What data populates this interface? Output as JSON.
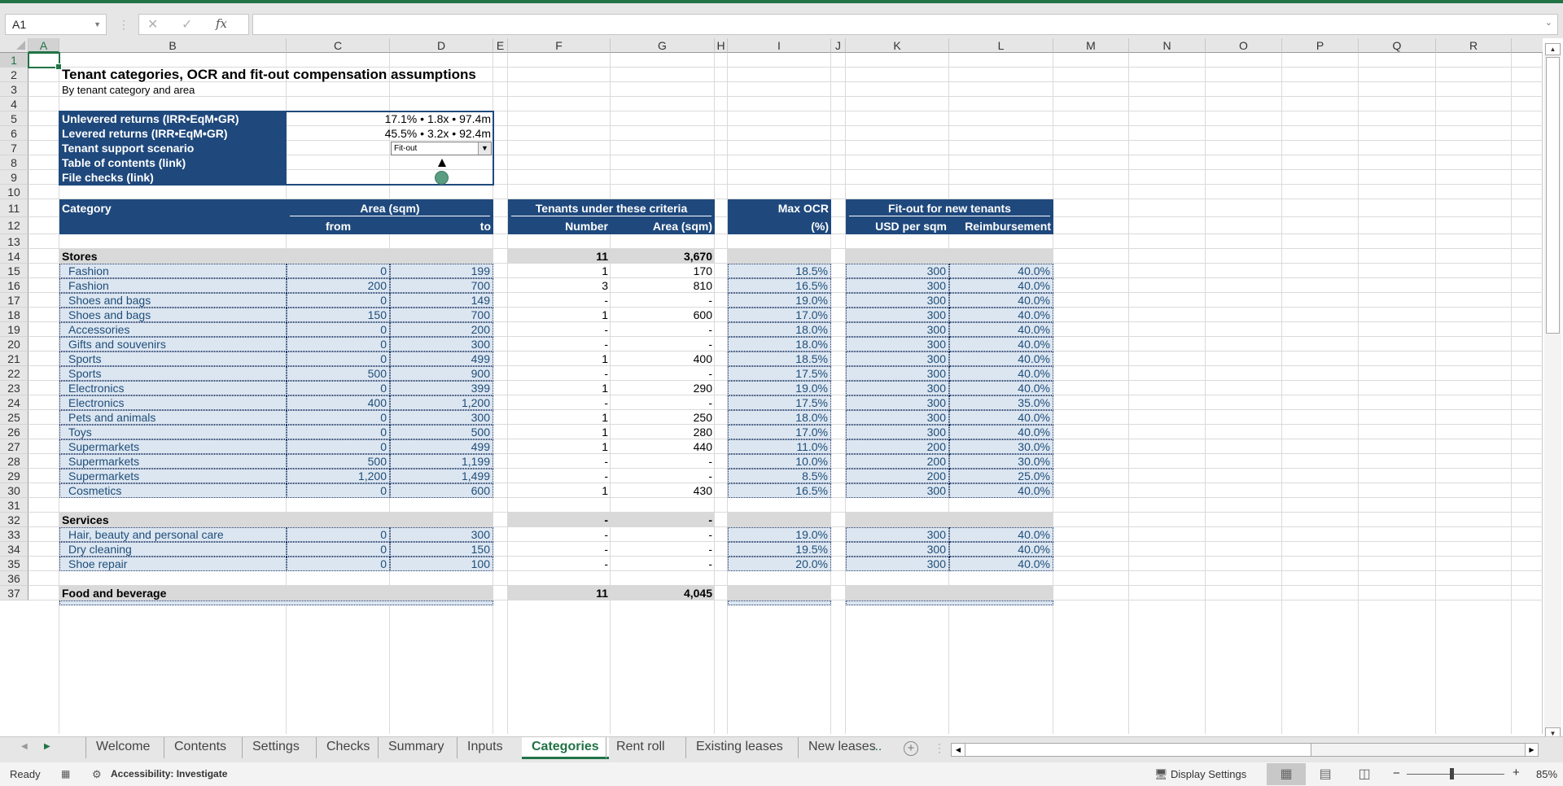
{
  "app": {
    "name_box": "A1",
    "formula_value": "",
    "formula_icons": [
      "cancel-icon",
      "enter-icon",
      "function-icon"
    ]
  },
  "columns": [
    "A",
    "B",
    "C",
    "D",
    "E",
    "F",
    "G",
    "H",
    "I",
    "J",
    "K",
    "L",
    "M",
    "N",
    "O",
    "P",
    "Q",
    "R"
  ],
  "rows": [
    "1",
    "2",
    "3",
    "4",
    "5",
    "6",
    "7",
    "8",
    "9",
    "10",
    "11",
    "12",
    "13",
    "14",
    "15",
    "16",
    "17",
    "18",
    "19",
    "20",
    "21",
    "22",
    "23",
    "24",
    "25",
    "26",
    "27",
    "28",
    "29",
    "30",
    "31",
    "32",
    "33",
    "34",
    "35",
    "36",
    "37"
  ],
  "sheet": {
    "title": "Tenant categories, OCR and fit-out compensation assumptions",
    "subtitle": "By tenant category and area",
    "summary_box": {
      "labels": [
        "Unlevered returns (IRR•EqM•GR)",
        "Levered returns (IRR•EqM•GR)",
        "Tenant support scenario",
        "Table of contents (link)",
        "File checks (link)"
      ],
      "unlevered": "17.1% • 1.8x • 97.4m",
      "levered": "45.5% • 3.2x • 92.4m",
      "scenario": "Fit-out",
      "toc_icon": "up-triangle-icon",
      "checks_icon": "status-circle-icon",
      "checks_color": "#5b9d83"
    },
    "headers": {
      "category": "Category",
      "area_group": "Area (sqm)",
      "area_from": "from",
      "area_to": "to",
      "tenants_group": "Tenants under these criteria",
      "tenants_number": "Number",
      "tenants_area": "Area (sqm)",
      "ocr_group": "Max OCR",
      "ocr_unit": "(%)",
      "fitout_group": "Fit-out for new tenants",
      "fitout_usd": "USD per sqm",
      "fitout_reimb": "Reimbursement"
    },
    "sections": [
      {
        "name": "Stores",
        "number": "11",
        "area": "3,670",
        "items": [
          {
            "category": "Fashion",
            "from": "0",
            "to": "199",
            "number": "1",
            "area": "170",
            "ocr": "18.5%",
            "usd": "300",
            "reimb": "40.0%"
          },
          {
            "category": "Fashion",
            "from": "200",
            "to": "700",
            "number": "3",
            "area": "810",
            "ocr": "16.5%",
            "usd": "300",
            "reimb": "40.0%"
          },
          {
            "category": "Shoes and bags",
            "from": "0",
            "to": "149",
            "number": "-",
            "area": "-",
            "ocr": "19.0%",
            "usd": "300",
            "reimb": "40.0%"
          },
          {
            "category": "Shoes and bags",
            "from": "150",
            "to": "700",
            "number": "1",
            "area": "600",
            "ocr": "17.0%",
            "usd": "300",
            "reimb": "40.0%"
          },
          {
            "category": "Accessories",
            "from": "0",
            "to": "200",
            "number": "-",
            "area": "-",
            "ocr": "18.0%",
            "usd": "300",
            "reimb": "40.0%"
          },
          {
            "category": "Gifts and souvenirs",
            "from": "0",
            "to": "300",
            "number": "-",
            "area": "-",
            "ocr": "18.0%",
            "usd": "300",
            "reimb": "40.0%"
          },
          {
            "category": "Sports",
            "from": "0",
            "to": "499",
            "number": "1",
            "area": "400",
            "ocr": "18.5%",
            "usd": "300",
            "reimb": "40.0%"
          },
          {
            "category": "Sports",
            "from": "500",
            "to": "900",
            "number": "-",
            "area": "-",
            "ocr": "17.5%",
            "usd": "300",
            "reimb": "40.0%"
          },
          {
            "category": "Electronics",
            "from": "0",
            "to": "399",
            "number": "1",
            "area": "290",
            "ocr": "19.0%",
            "usd": "300",
            "reimb": "40.0%"
          },
          {
            "category": "Electronics",
            "from": "400",
            "to": "1,200",
            "number": "-",
            "area": "-",
            "ocr": "17.5%",
            "usd": "300",
            "reimb": "35.0%"
          },
          {
            "category": "Pets and animals",
            "from": "0",
            "to": "300",
            "number": "1",
            "area": "250",
            "ocr": "18.0%",
            "usd": "300",
            "reimb": "40.0%"
          },
          {
            "category": "Toys",
            "from": "0",
            "to": "500",
            "number": "1",
            "area": "280",
            "ocr": "17.0%",
            "usd": "300",
            "reimb": "40.0%"
          },
          {
            "category": "Supermarkets",
            "from": "0",
            "to": "499",
            "number": "1",
            "area": "440",
            "ocr": "11.0%",
            "usd": "200",
            "reimb": "30.0%"
          },
          {
            "category": "Supermarkets",
            "from": "500",
            "to": "1,199",
            "number": "-",
            "area": "-",
            "ocr": "10.0%",
            "usd": "200",
            "reimb": "30.0%"
          },
          {
            "category": "Supermarkets",
            "from": "1,200",
            "to": "1,499",
            "number": "-",
            "area": "-",
            "ocr": "8.5%",
            "usd": "200",
            "reimb": "25.0%"
          },
          {
            "category": "Cosmetics",
            "from": "0",
            "to": "600",
            "number": "1",
            "area": "430",
            "ocr": "16.5%",
            "usd": "300",
            "reimb": "40.0%"
          }
        ]
      },
      {
        "name": "Services",
        "number": "-",
        "area": "-",
        "items": [
          {
            "category": "Hair, beauty and personal care",
            "from": "0",
            "to": "300",
            "number": "-",
            "area": "-",
            "ocr": "19.0%",
            "usd": "300",
            "reimb": "40.0%"
          },
          {
            "category": "Dry cleaning",
            "from": "0",
            "to": "150",
            "number": "-",
            "area": "-",
            "ocr": "19.5%",
            "usd": "300",
            "reimb": "40.0%"
          },
          {
            "category": "Shoe repair",
            "from": "0",
            "to": "100",
            "number": "-",
            "area": "-",
            "ocr": "20.0%",
            "usd": "300",
            "reimb": "40.0%"
          }
        ]
      },
      {
        "name": "Food and beverage",
        "number": "11",
        "area": "4,045",
        "items": []
      }
    ]
  },
  "tabs": {
    "items": [
      "Welcome",
      "Contents",
      "Settings",
      "Checks",
      "Summary",
      "Inputs",
      "Categories",
      "Rent roll",
      "Existing leases",
      "New leases"
    ],
    "active": "Categories",
    "more": "...",
    "add_label": "+"
  },
  "status": {
    "ready": "Ready",
    "accessibility": "Accessibility: Investigate",
    "display_settings": "Display Settings",
    "zoom": "85%",
    "zoom_minus": "−",
    "zoom_plus": "+"
  },
  "colors": {
    "excel_green": "#217346",
    "header_navy": "#1f497d",
    "input_fill": "#dce6f1",
    "section_gray": "#d9d9d9"
  }
}
